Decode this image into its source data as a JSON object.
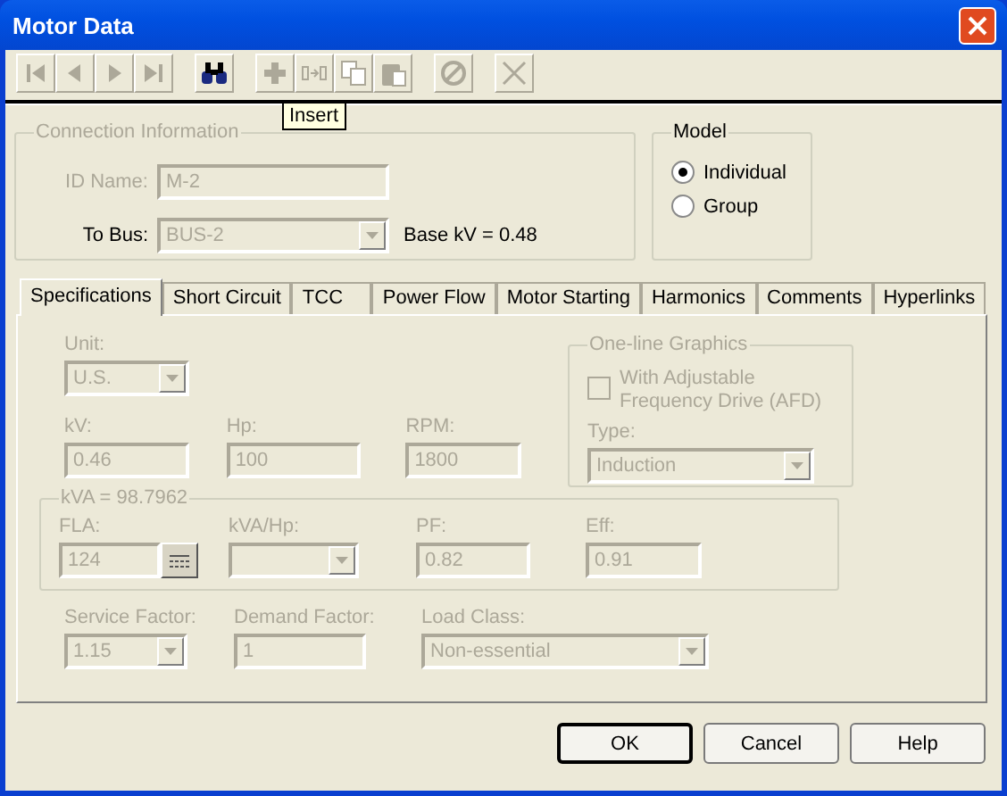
{
  "window": {
    "title": "Motor Data"
  },
  "toolbar": [
    {
      "buttons": [
        {
          "kind": "first",
          "disabled": true
        },
        {
          "kind": "prev",
          "disabled": true
        },
        {
          "kind": "next",
          "disabled": true
        },
        {
          "kind": "last",
          "disabled": true
        }
      ]
    },
    {
      "buttons": [
        {
          "kind": "find",
          "disabled": false
        }
      ]
    },
    {
      "buttons": [
        {
          "kind": "add",
          "disabled": true
        },
        {
          "kind": "insert",
          "disabled": true
        },
        {
          "kind": "copy",
          "disabled": true
        },
        {
          "kind": "paste",
          "disabled": true
        }
      ]
    },
    {
      "buttons": [
        {
          "kind": "undo",
          "disabled": true
        }
      ]
    },
    {
      "buttons": [
        {
          "kind": "delete",
          "disabled": true
        }
      ]
    }
  ],
  "tooltip": "Insert",
  "connection": {
    "legend": "Connection Information",
    "id_name": {
      "label": "ID Name:",
      "value": "M-2",
      "disabled": true
    },
    "to_bus": {
      "label": "To Bus:",
      "value": "BUS-2",
      "disabled": true
    },
    "base_kv": "Base kV = 0.48"
  },
  "model": {
    "legend": "Model",
    "options": [
      {
        "label": "Individual",
        "selected": true
      },
      {
        "label": "Group",
        "selected": false
      }
    ]
  },
  "tabs": [
    {
      "label": "Specifications",
      "selected": true
    },
    {
      "label": "Short Circuit",
      "selected": false
    },
    {
      "label": "TCC",
      "selected": false
    },
    {
      "label": "Power Flow",
      "selected": false
    },
    {
      "label": "Motor Starting",
      "selected": false
    },
    {
      "label": "Harmonics",
      "selected": false
    },
    {
      "label": "Comments",
      "selected": false
    },
    {
      "label": "Hyperlinks",
      "selected": false
    }
  ],
  "specifications": {
    "unit": {
      "label": "Unit:",
      "value": "U.S.",
      "disabled": true
    },
    "ratings": [
      {
        "label": "kV:",
        "value": "0.46",
        "disabled": true
      },
      {
        "label": "Hp:",
        "value": "100",
        "disabled": true
      },
      {
        "label": "RPM:",
        "value": "1800",
        "disabled": true
      }
    ],
    "one_line": {
      "legend": "One-line Graphics",
      "checkbox": {
        "label": "With Adjustable Frequency Drive (AFD)",
        "checked": false,
        "disabled": true
      },
      "type": {
        "label": "Type:",
        "value": "Induction",
        "disabled": true
      }
    },
    "kva": {
      "legend": "kVA = 98.7962",
      "fields": [
        {
          "label": "FLA:",
          "value": "124",
          "kind": "calc",
          "disabled": true
        },
        {
          "label": "kVA/Hp:",
          "kind": "dropdown",
          "disabled": true
        },
        {
          "label": "PF:",
          "value": "0.82",
          "kind": "text",
          "disabled": true
        },
        {
          "label": "Eff:",
          "value": "0.91",
          "kind": "text",
          "disabled": true
        }
      ]
    },
    "other": [
      {
        "label": "Service Factor:",
        "value": "1.15",
        "kind": "dropdown",
        "disabled": true
      },
      {
        "label": "Demand Factor:",
        "value": "1",
        "kind": "text",
        "disabled": true
      },
      {
        "label": "Load Class:",
        "value": "Non-essential",
        "kind": "dropdown",
        "disabled": true
      }
    ]
  },
  "buttons": [
    {
      "label": "OK",
      "default": true
    },
    {
      "label": "Cancel",
      "default": false
    },
    {
      "label": "Help",
      "default": false
    }
  ]
}
